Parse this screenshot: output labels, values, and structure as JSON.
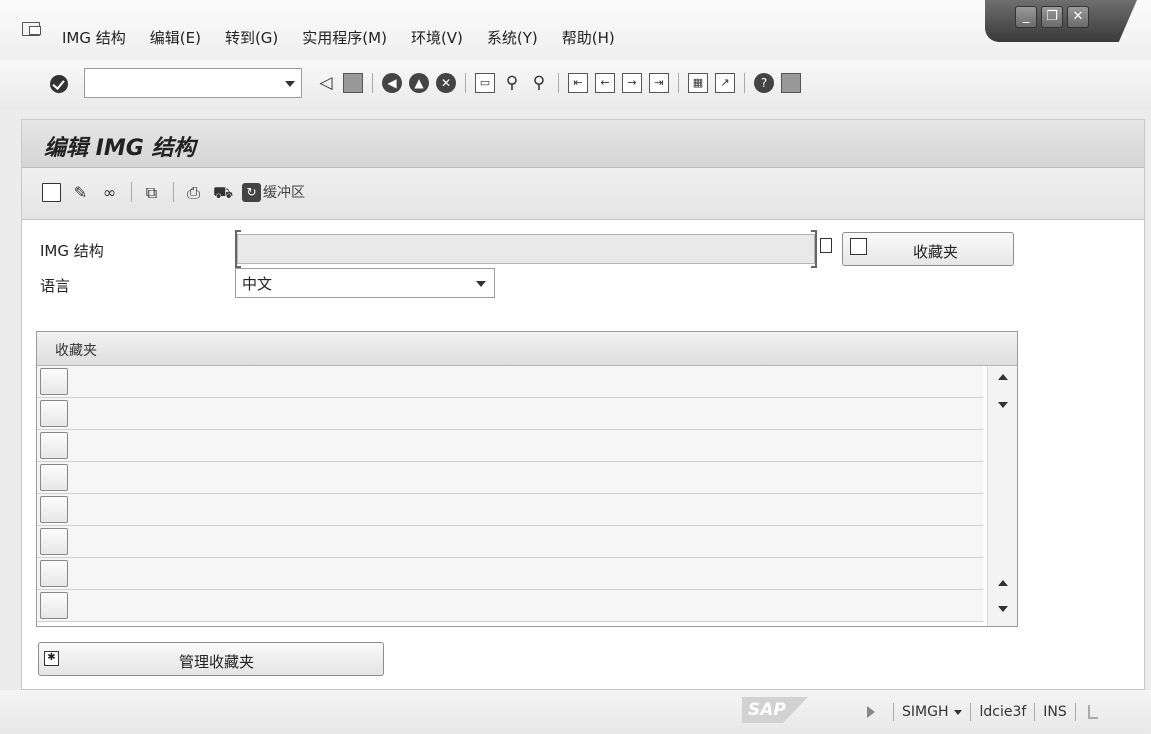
{
  "menu": {
    "items": [
      "IMG 结构",
      "编辑(E)",
      "转到(G)",
      "实用程序(M)",
      "环境(V)",
      "系统(Y)",
      "帮助(H)"
    ]
  },
  "window_controls": {
    "minimize": "_",
    "restore": "❐",
    "close": "✕"
  },
  "toolbar": {
    "command_field_value": "",
    "icons": [
      "ok-icon",
      "back-arrow-icon",
      "save-icon",
      "back-icon",
      "exit-icon",
      "cancel-icon",
      "print-icon",
      "find-icon",
      "find-next-icon",
      "first-page-icon",
      "prev-page-icon",
      "next-page-icon",
      "last-page-icon",
      "new-session-icon",
      "shortcut-icon",
      "help-icon",
      "layout-icon"
    ]
  },
  "page": {
    "title": "编辑 IMG 结构"
  },
  "app_toolbar": {
    "buffer_label": "缓冲区"
  },
  "form": {
    "img_label": "IMG 结构",
    "img_value": "",
    "favorites_button": "收藏夹",
    "language_label": "语言",
    "language_value": "中文"
  },
  "table": {
    "header": "收藏夹",
    "rows": [
      "",
      "",
      "",
      "",
      "",
      "",
      "",
      ""
    ]
  },
  "manage_button": "管理收藏夹",
  "status": {
    "logo": "SAP",
    "system": "SIMGH",
    "server": "ldcie3f",
    "mode": "INS"
  }
}
